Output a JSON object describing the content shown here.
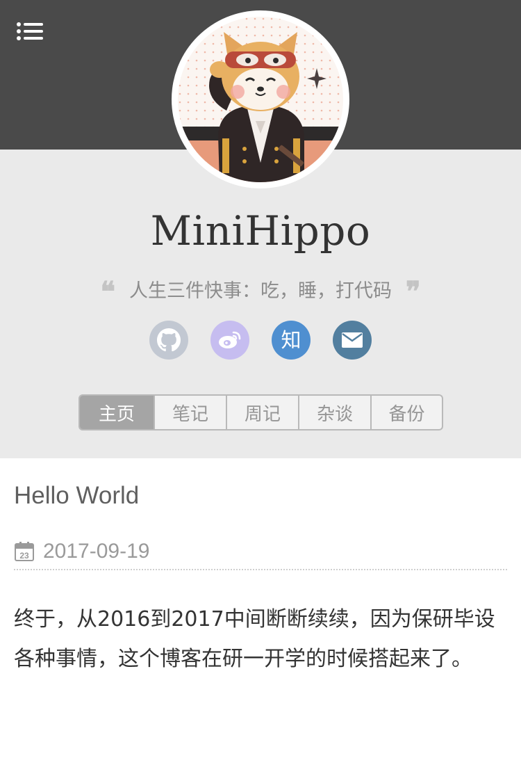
{
  "header": {
    "menu_icon": "list-menu-icon",
    "background_color": "#4a4a4a"
  },
  "profile": {
    "avatar_alt": "shiba-inu-avatar",
    "site_name": "MiniHippo",
    "motto": "人生三件快事：吃，睡，打代码",
    "quote_open": "❝",
    "quote_close": "❞",
    "socials": [
      {
        "name": "github",
        "icon": "github-icon",
        "color": "#c2c8d2"
      },
      {
        "name": "weibo",
        "icon": "weibo-icon",
        "color": "#c6bdf0"
      },
      {
        "name": "zhihu",
        "icon": "zhihu-icon",
        "label": "知",
        "color": "#4f8fd0"
      },
      {
        "name": "email",
        "icon": "mail-icon",
        "color": "#527f9f"
      }
    ]
  },
  "nav": {
    "tabs": [
      {
        "label": "主页",
        "active": true
      },
      {
        "label": "笔记",
        "active": false
      },
      {
        "label": "周记",
        "active": false
      },
      {
        "label": "杂谈",
        "active": false
      },
      {
        "label": "备份",
        "active": false
      }
    ]
  },
  "post": {
    "title": "Hello World",
    "calendar_day": "23",
    "date": "2017-09-19",
    "body": "终于，从2016到2017中间断断续续，因为保研毕设各种事情，这个博客在研一开学的时候搭起来了。"
  }
}
